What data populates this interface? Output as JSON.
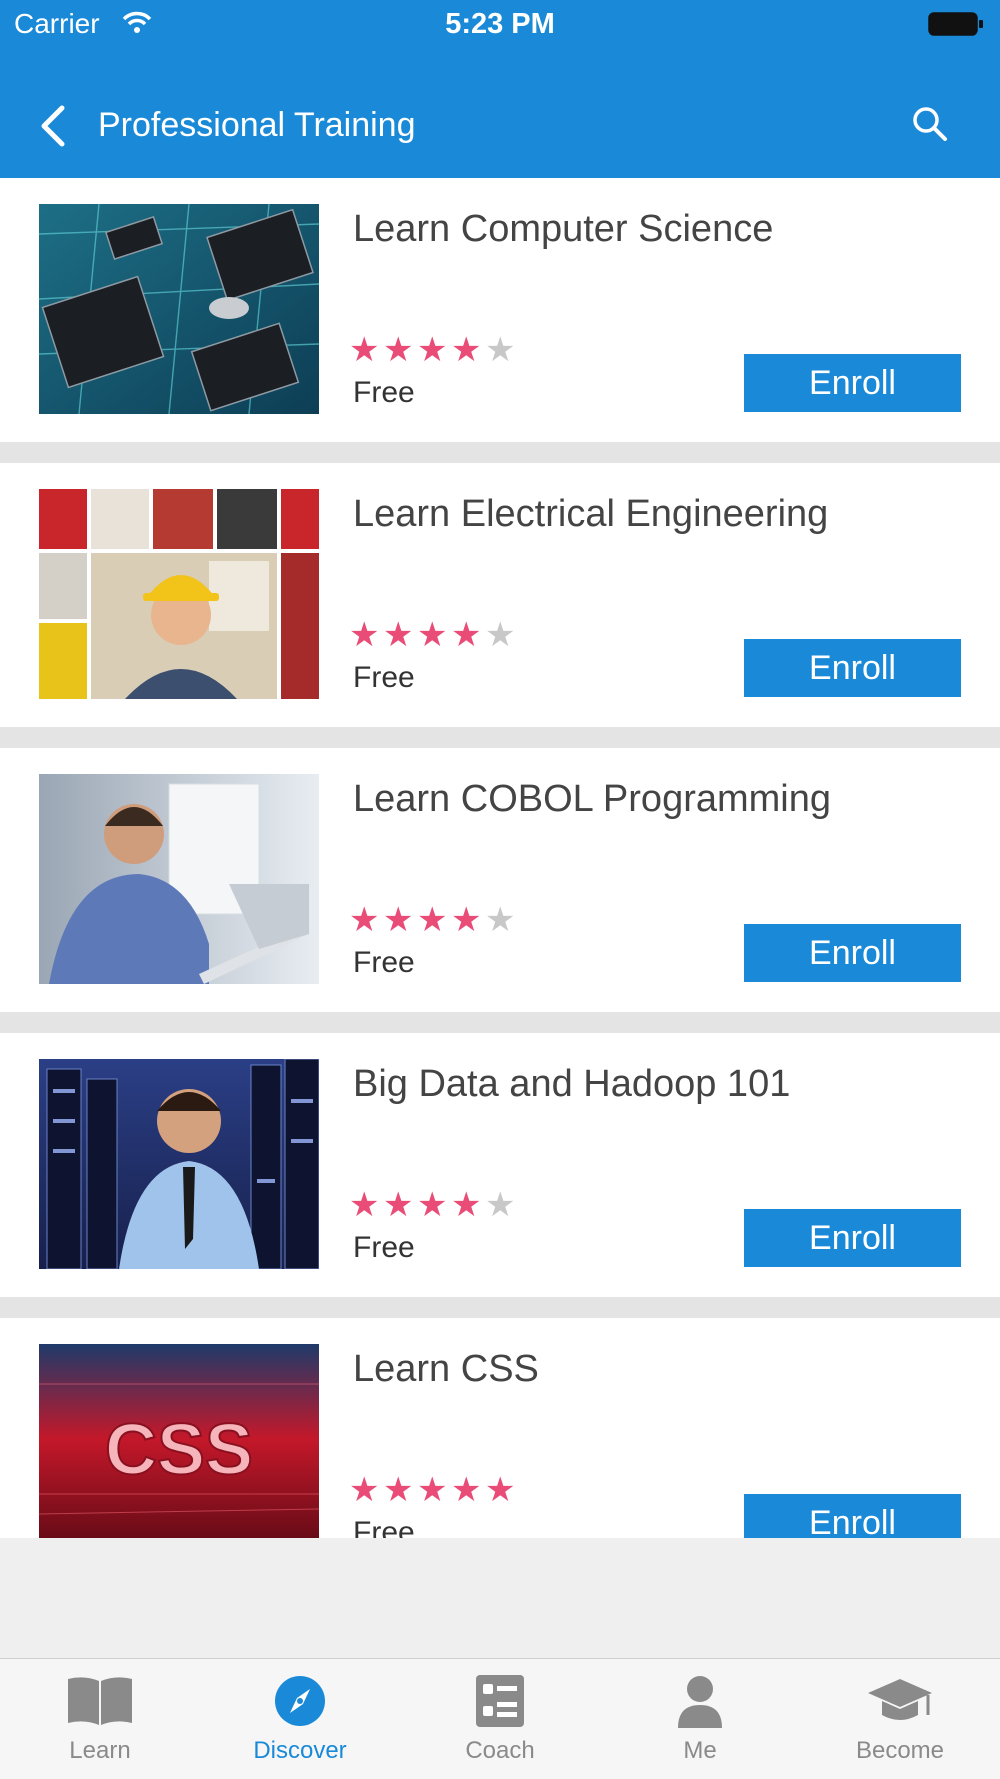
{
  "status_bar": {
    "carrier": "Carrier",
    "time": "5:23 PM"
  },
  "nav": {
    "title": "Professional Training"
  },
  "colors": {
    "accent": "#1a8ad8",
    "star_on": "#e94d77",
    "star_off": "#c8c8c8"
  },
  "courses": [
    {
      "title": "Learn Computer Science",
      "rating": 4,
      "max_rating": 5,
      "price": "Free",
      "action": "Enroll",
      "image": "circuit-board-image"
    },
    {
      "title": "Learn Electrical Engineering",
      "rating": 4,
      "max_rating": 5,
      "price": "Free",
      "action": "Enroll",
      "image": "electrician-collage-image"
    },
    {
      "title": "Learn COBOL Programming",
      "rating": 4,
      "max_rating": 5,
      "price": "Free",
      "action": "Enroll",
      "image": "man-with-laptop-image"
    },
    {
      "title": "Big Data and Hadoop 101",
      "rating": 4,
      "max_rating": 5,
      "price": "Free",
      "action": "Enroll",
      "image": "server-room-man-image"
    },
    {
      "title": "Learn CSS",
      "rating": 5,
      "max_rating": 5,
      "price": "Free",
      "action": "Enroll",
      "image": "css-red-text-image"
    }
  ],
  "tabs": [
    {
      "label": "Learn",
      "icon": "book-icon",
      "active": false
    },
    {
      "label": "Discover",
      "icon": "compass-icon",
      "active": true
    },
    {
      "label": "Coach",
      "icon": "list-icon",
      "active": false
    },
    {
      "label": "Me",
      "icon": "person-icon",
      "active": false
    },
    {
      "label": "Become",
      "icon": "graduation-cap-icon",
      "active": false
    }
  ]
}
